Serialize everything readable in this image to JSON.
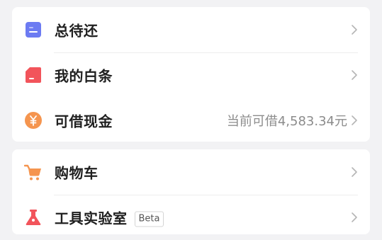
{
  "colors": {
    "background": "#f2f2f4",
    "card": "#ffffff",
    "text_primary": "#1f1f1f",
    "text_secondary": "#8c8c8c",
    "icon_blue": "#6c7bf2",
    "icon_red": "#f2545b",
    "icon_orange": "#f5954f"
  },
  "section_1": {
    "items": [
      {
        "label": "总待还",
        "icon": "bill-icon"
      },
      {
        "label": "我的白条",
        "icon": "card-icon"
      },
      {
        "label": "可借现金",
        "value": "当前可借4,583.34元",
        "icon": "yen-coin-icon"
      }
    ]
  },
  "section_2": {
    "items": [
      {
        "label": "购物车",
        "icon": "shopping-cart-icon"
      },
      {
        "label": "工具实验室",
        "badge": "Beta",
        "icon": "flask-icon"
      }
    ]
  }
}
